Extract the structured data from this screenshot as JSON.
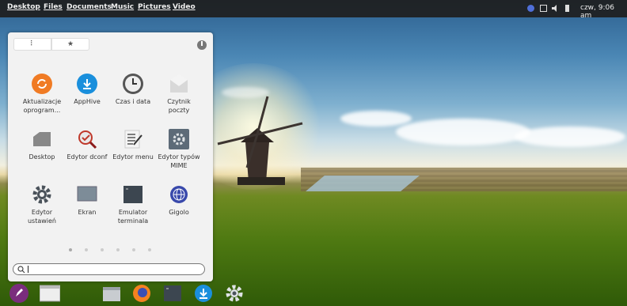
{
  "topbar": {
    "menu": [
      "Desktop",
      "Files",
      "Documents",
      "Music",
      "Pictures",
      "Video"
    ],
    "clock": "czw, 9:06 am"
  },
  "launcher": {
    "view_toggle": [
      "⠇",
      "★"
    ],
    "apps": [
      {
        "label": "Aktualizacje oprogram...",
        "icon": "update-icon"
      },
      {
        "label": "AppHive",
        "icon": "download-icon"
      },
      {
        "label": "Czas i data",
        "icon": "clock-icon"
      },
      {
        "label": "Czytnik poczty",
        "icon": "mail-icon"
      },
      {
        "label": "Desktop",
        "icon": "desktop-folder-icon"
      },
      {
        "label": "Edytor dconf",
        "icon": "dconf-icon"
      },
      {
        "label": "Edytor menu",
        "icon": "menu-editor-icon"
      },
      {
        "label": "Edytor typów MIME",
        "icon": "mime-gear-icon"
      },
      {
        "label": "Edytor ustawień",
        "icon": "settings-gear-icon"
      },
      {
        "label": "Ekran",
        "icon": "display-icon"
      },
      {
        "label": "Emulator terminala",
        "icon": "terminal-icon"
      },
      {
        "label": "Gigolo",
        "icon": "globe-icon"
      }
    ],
    "page_count": 6,
    "search": {
      "value": "",
      "placeholder": ""
    }
  },
  "dock": [
    "launcher-rocket-icon",
    "window-icon",
    "files-icon",
    "firefox-icon",
    "terminal-icon",
    "apphive-icon",
    "settings-icon"
  ]
}
